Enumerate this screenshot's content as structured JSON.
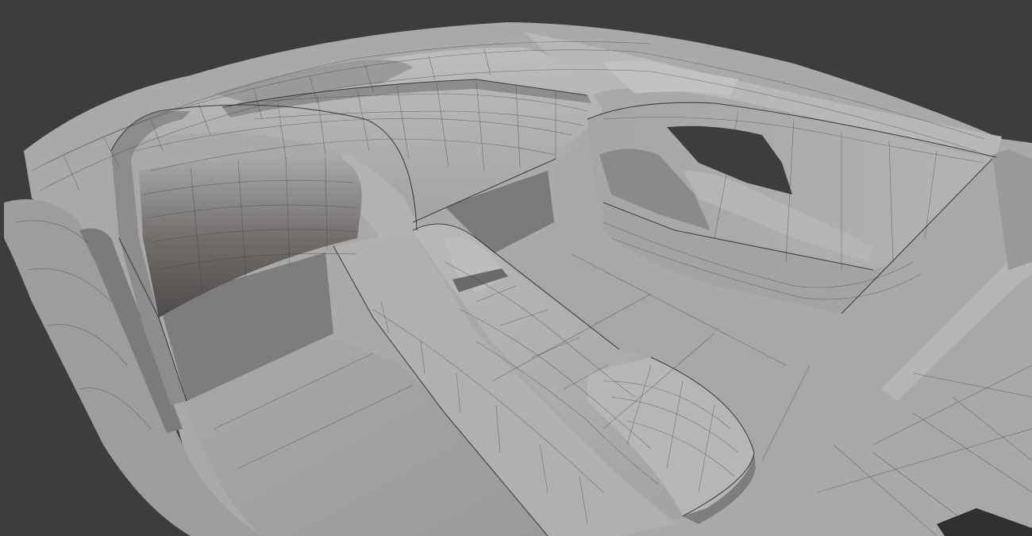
{
  "viewport": {
    "background_color": "#3d3d3d",
    "mesh_light_color": "#b4b4b4",
    "mesh_mid_color": "#9c9c9c",
    "mesh_dark_color": "#6e6e6e",
    "wire_color": "#3a3a3a"
  }
}
